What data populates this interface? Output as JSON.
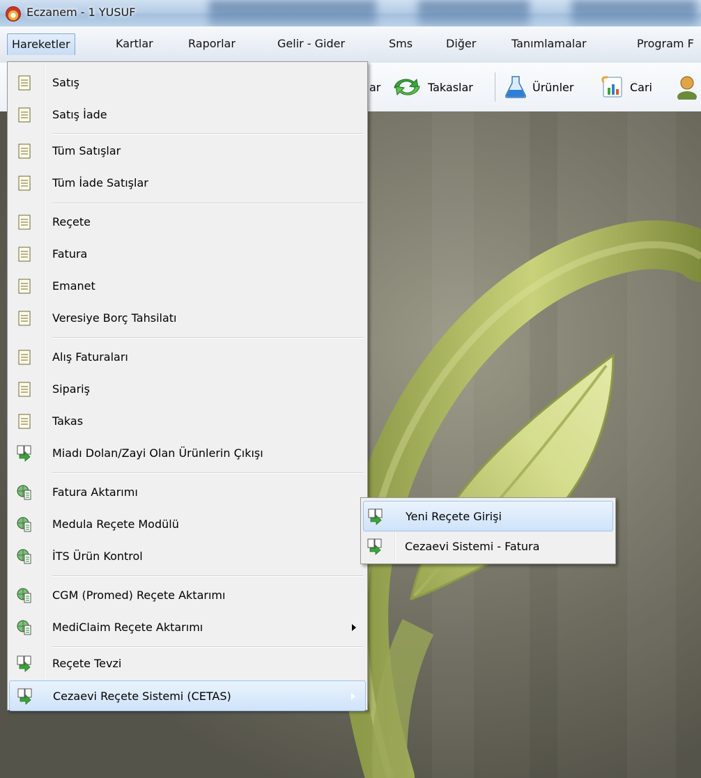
{
  "window": {
    "title": "Eczanem - 1 YUSUF"
  },
  "menubar": {
    "items": [
      {
        "label": "Hareketler",
        "active": true
      },
      {
        "label": "Kartlar"
      },
      {
        "label": "Raporlar"
      },
      {
        "label": "Gelir - Gider"
      },
      {
        "label": "Sms"
      },
      {
        "label": "Diğer"
      },
      {
        "label": "Tanımlamalar"
      },
      {
        "label": "Program F"
      }
    ]
  },
  "toolbar": {
    "items": [
      {
        "label": "ar",
        "icon": "truncated-icon"
      },
      {
        "label": "Takaslar",
        "icon": "swap-arrows-icon"
      },
      {
        "label": "Ürünler",
        "icon": "flask-icon"
      },
      {
        "label": "Cari",
        "icon": "chart-document-icon"
      }
    ]
  },
  "menu": {
    "items": [
      {
        "label": "Satış",
        "icon": "document-icon"
      },
      {
        "label": "Satış İade",
        "icon": "document-icon"
      },
      {
        "label": "Tüm Satışlar",
        "icon": "document-icon"
      },
      {
        "label": "Tüm İade Satışlar",
        "icon": "document-icon"
      },
      {
        "label": "Reçete",
        "icon": "document-icon"
      },
      {
        "label": "Fatura",
        "icon": "document-icon"
      },
      {
        "label": "Emanet",
        "icon": "document-icon"
      },
      {
        "label": "Veresiye Borç Tahsilatı",
        "icon": "document-icon"
      },
      {
        "label": "Alış Faturaları",
        "icon": "document-icon"
      },
      {
        "label": "Sipariş",
        "icon": "document-icon"
      },
      {
        "label": "Takas",
        "icon": "document-icon"
      },
      {
        "label": "Miadı Dolan/Zayi Olan Ürünlerin Çıkışı",
        "icon": "document-transfer-icon"
      },
      {
        "label": "Fatura Aktarımı",
        "icon": "globe-document-icon"
      },
      {
        "label": "Medula Reçete Modülü",
        "icon": "globe-document-icon"
      },
      {
        "label": "İTS Ürün Kontrol",
        "icon": "globe-document-icon"
      },
      {
        "label": "CGM (Promed) Reçete Aktarımı",
        "icon": "globe-document-icon"
      },
      {
        "label": "MediClaim Reçete Aktarımı",
        "icon": "globe-document-icon",
        "submenu": true
      },
      {
        "label": "Reçete Tevzi",
        "icon": "document-transfer-icon"
      },
      {
        "label": "Cezaevi Reçete Sistemi (CETAS)",
        "icon": "document-transfer-icon",
        "submenu": true,
        "highlighted": true
      }
    ]
  },
  "submenu": {
    "items": [
      {
        "label": "Yeni Reçete Girişi",
        "icon": "document-transfer-icon",
        "highlighted": true
      },
      {
        "label": "Cezaevi Sistemi - Fatura",
        "icon": "document-transfer-icon"
      }
    ]
  },
  "colors": {
    "highlight": "#cfe3fa",
    "menu_bg": "#f0f0f0",
    "leaf": "#b8c266"
  }
}
